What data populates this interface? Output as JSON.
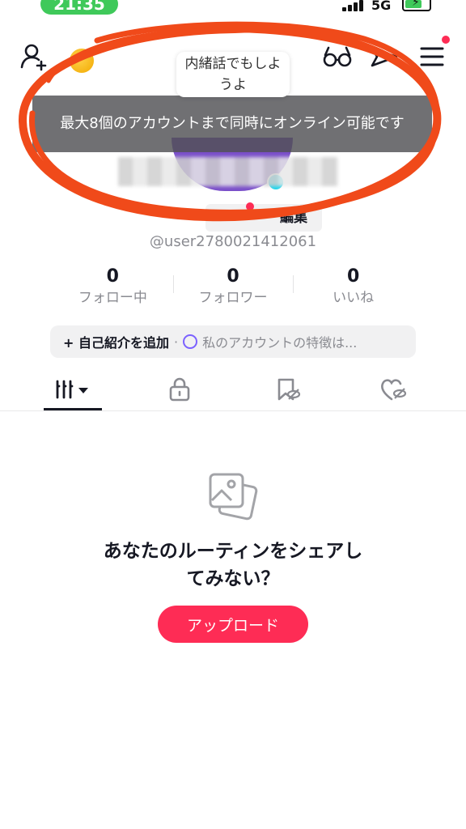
{
  "status_bar": {
    "time": "21:35",
    "network": "5G",
    "status_color": "#3fc95a"
  },
  "top_nav": {
    "bubble_text": "内緒話でもしようよ",
    "icons": [
      "add-user-icon",
      "glasses-icon",
      "share-icon",
      "menu-icon"
    ]
  },
  "toast": {
    "text": "最大8個のアカウントまで同時にオンライン可能です"
  },
  "profile": {
    "edit_label": "編集",
    "username": "@user2780021412061"
  },
  "stats": [
    {
      "value": "0",
      "label": "フォロー中"
    },
    {
      "value": "0",
      "label": "フォロワー"
    },
    {
      "value": "0",
      "label": "いいね"
    }
  ],
  "bio": {
    "add_label": "+ 自己紹介を追加",
    "hint": "私のアカウントの特徴は..."
  },
  "tabs": [
    {
      "name": "videos-tab",
      "icon": "grid-icon",
      "active": true
    },
    {
      "name": "private-tab",
      "icon": "lock-icon",
      "active": false
    },
    {
      "name": "favorites-tab",
      "icon": "bookmark-hidden-icon",
      "active": false
    },
    {
      "name": "liked-tab",
      "icon": "heart-hidden-icon",
      "active": false
    }
  ],
  "empty_state": {
    "title_line1": "あなたのルーティンをシェアし",
    "title_line2": "てみない？",
    "upload_label": "アップロード"
  },
  "colors": {
    "accent": "#fe2c55",
    "annotation": "#f04a1a"
  }
}
